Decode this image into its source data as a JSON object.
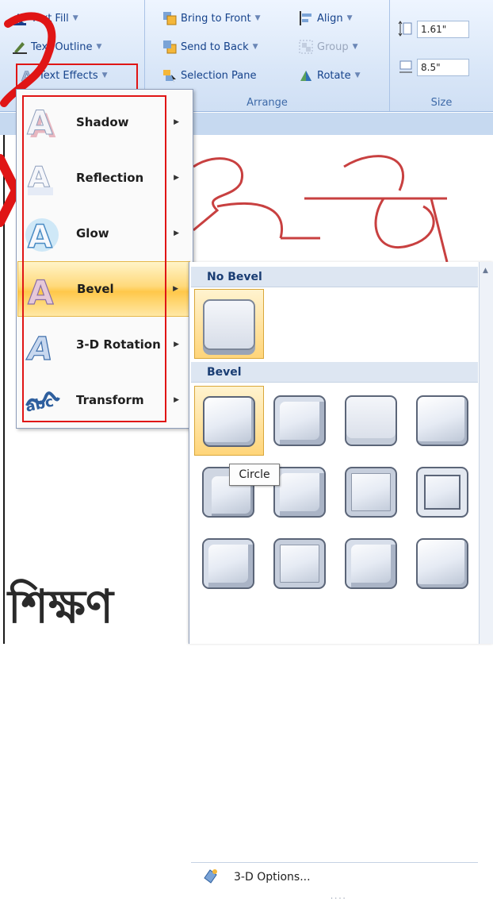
{
  "ribbon": {
    "wordart_styles": {
      "text_fill": "Text Fill",
      "text_outline": "Text Outline",
      "text_effects": "Text Effects"
    },
    "arrange": {
      "label": "Arrange",
      "bring_to_front": "Bring to Front",
      "send_to_back": "Send to Back",
      "selection_pane": "Selection Pane",
      "align": "Align",
      "group": "Group",
      "rotate": "Rotate"
    },
    "size": {
      "label": "Size",
      "height": "1.61\"",
      "width": "8.5\""
    }
  },
  "text_effects_menu": {
    "items": [
      {
        "label": "Shadow"
      },
      {
        "label": "Reflection"
      },
      {
        "label": "Glow"
      },
      {
        "label": "Bevel"
      },
      {
        "label": "3-D Rotation"
      },
      {
        "label": "Transform"
      }
    ]
  },
  "bevel_gallery": {
    "no_bevel_header": "No Bevel",
    "bevel_header": "Bevel",
    "tooltip": "Circle",
    "options_label": "3-D Options...",
    "grip": "...."
  },
  "document": {
    "bengali_text": "শিক্ষণ"
  },
  "colors": {
    "accent_highlight": "#e01515",
    "ribbon_text": "#15428b",
    "hover_gold": "#ffd97a"
  }
}
